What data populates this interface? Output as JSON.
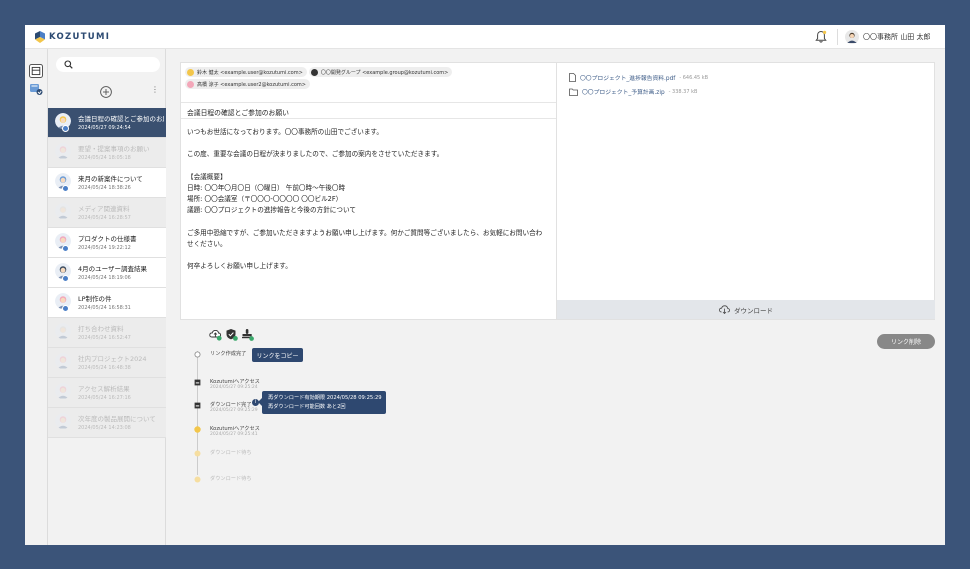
{
  "app": {
    "brand": "KOZUTUMI"
  },
  "header": {
    "user_name": "〇〇事務所 山田 太郎"
  },
  "sidebar": {
    "threads": [
      {
        "title": "会議日程の確認とご参加のお願い",
        "date": "2024/05/27 09:24:54",
        "state": "active",
        "avatar_color": "#f3c64a"
      },
      {
        "title": "要望・提案事項のお願い",
        "date": "2024/05/24 18:05:18",
        "state": "dim",
        "avatar_color": "#f3a7b9"
      },
      {
        "title": "来月の新案件について",
        "date": "2024/05/24 18:38:26",
        "state": "normal",
        "avatar_color": "#6a9bd6"
      },
      {
        "title": "メディア関連資料",
        "date": "2024/05/24 16:28:57",
        "state": "dim",
        "avatar_color": "#d8d8d8"
      },
      {
        "title": "プロダクトの仕様書",
        "date": "2024/05/24 19:22:12",
        "state": "normal",
        "avatar_color": "#f0a8c0"
      },
      {
        "title": "4月のユーザー調査結果",
        "date": "2024/05/24 18:19:06",
        "state": "normal",
        "avatar_color": "#3a4b5f"
      },
      {
        "title": "LP制作の件",
        "date": "2024/05/24 16:58:31",
        "state": "normal",
        "avatar_color": "#f3a7b9"
      },
      {
        "title": "打ち合わせ資料",
        "date": "2024/05/24 16:52:47",
        "state": "dim",
        "avatar_color": "#d8d8d8"
      },
      {
        "title": "社内プロジェクト2024",
        "date": "2024/05/24 16:48:38",
        "state": "dim",
        "avatar_color": "#f3a7b9"
      },
      {
        "title": "アクセス解析結果",
        "date": "2024/05/24 16:27:16",
        "state": "dim",
        "avatar_color": "#f3a7b9"
      },
      {
        "title": "次年度の製品展開について",
        "date": "2024/05/24 14:23:08",
        "state": "dim",
        "avatar_color": "#f3a7b9"
      }
    ]
  },
  "mail": {
    "recipients": [
      {
        "label": "鈴木 健太 <example.user@kozutumi.com>",
        "color": "#f3c64a"
      },
      {
        "label": "〇〇開発グループ <example.group@kozutumi.com>",
        "color": "#333333"
      },
      {
        "label": "高橋 涼子 <example.user2@kozutumi.com>",
        "color": "#f3a7b9"
      }
    ],
    "subject": "会議日程の確認とご参加のお願い",
    "body": [
      "いつもお世話になっております。〇〇事務所の山田でございます。",
      "",
      "この度、重要な会議の日程が決まりましたので、ご参加の案内をさせていただきます。",
      "",
      "【会議概要】",
      "日時: 〇〇年〇月〇日（〇曜日） 午前〇時～午後〇時",
      "場所: 〇〇会議室（〒〇〇〇-〇〇〇〇 〇〇ビル2F）",
      "議題: 〇〇プロジェクトの進捗報告と今後の方針について",
      "",
      "ご多用中恐縮ですが、ご参加いただきますようお願い申し上げます。何かご質問等ございましたら、お気軽にお問い合わ",
      "せください。",
      "",
      "何卒よろしくお願い申し上げます。"
    ]
  },
  "files": {
    "items": [
      {
        "name": "〇〇プロジェクト_進捗報告資料.pdf",
        "size": "- 646.45 kB",
        "icon": "file-icon"
      },
      {
        "name": "〇〇プロジェクト_予算計画.zip",
        "size": "- 338.37 kB",
        "icon": "folder-icon"
      }
    ],
    "download_label": "ダウンロード"
  },
  "timeline": {
    "copy_link_label": "リンクをコピー",
    "delete_link_label": "リンク削除",
    "events": [
      {
        "title": "リンク作成完了",
        "date": "",
        "state": "normal"
      },
      {
        "title": "Kozutumiへアクセス",
        "date": "2024/05/27 09:25:24",
        "state": "normal"
      },
      {
        "title": "ダウンロード完了",
        "date": "2024/05/27 09:25:29",
        "state": "normal"
      },
      {
        "title": "Kozutumiへアクセス",
        "date": "2024/05/27 09:25:41",
        "state": "normal"
      },
      {
        "title": "ダウンロード待ち",
        "date": "",
        "state": "faded"
      },
      {
        "title": "ダウンロード待ち",
        "date": "",
        "state": "faded"
      }
    ],
    "tooltip": {
      "line1": "再ダウンロード有効期限 2024/05/28 09:25:29",
      "line2": "再ダウンロード可能回数 あと2回"
    }
  }
}
